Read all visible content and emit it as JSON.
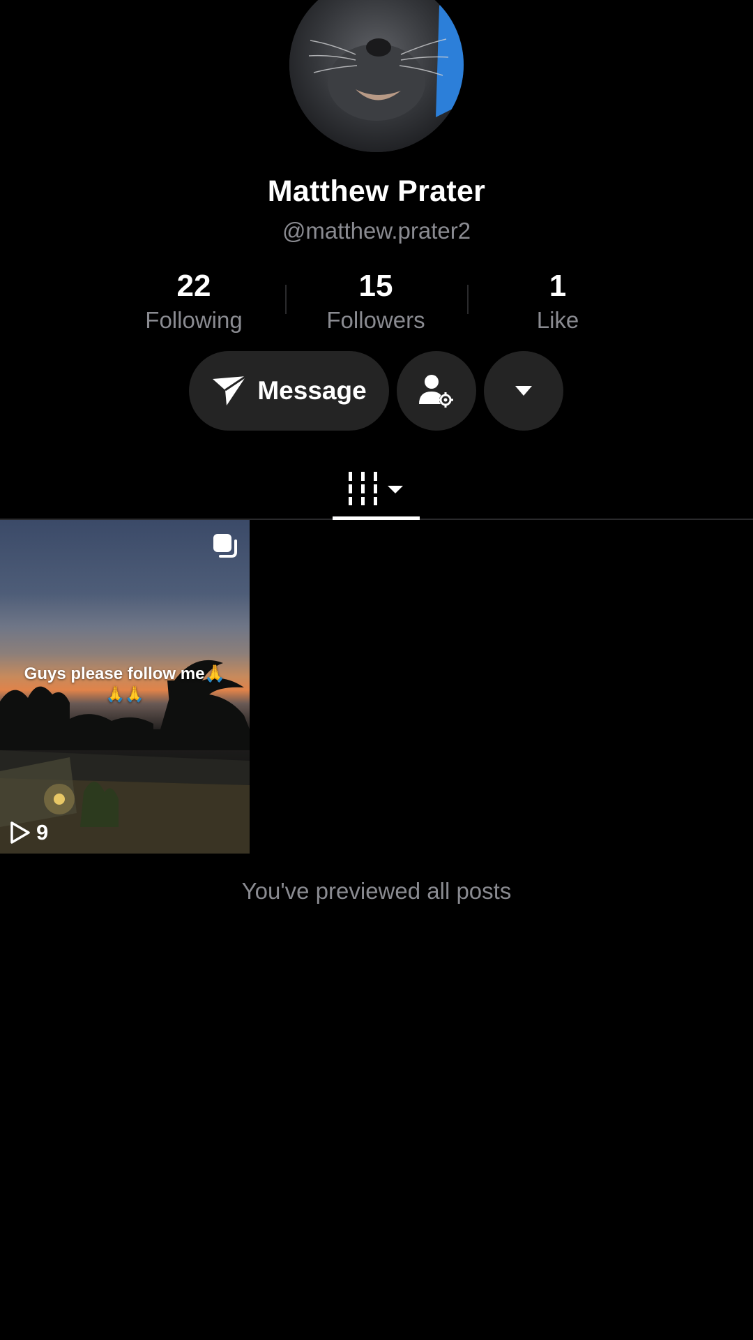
{
  "profile": {
    "display_name": "Matthew Prater",
    "handle": "@matthew.prater2"
  },
  "stats": [
    {
      "value": "22",
      "label": "Following"
    },
    {
      "value": "15",
      "label": "Followers"
    },
    {
      "value": "1",
      "label": "Like"
    }
  ],
  "actions": {
    "message_label": "Message"
  },
  "tabs": {
    "active": "videos-grid-icon"
  },
  "posts": [
    {
      "caption": "Guys please follow me🙏",
      "caption_emoji": "🙏🙏",
      "views": "9"
    }
  ],
  "footer": {
    "end_note": "You've previewed all posts"
  },
  "colors": {
    "background": "#000000",
    "button_bg": "#242424",
    "muted_text": "#8a8b91",
    "primary_text": "#ffffff"
  }
}
